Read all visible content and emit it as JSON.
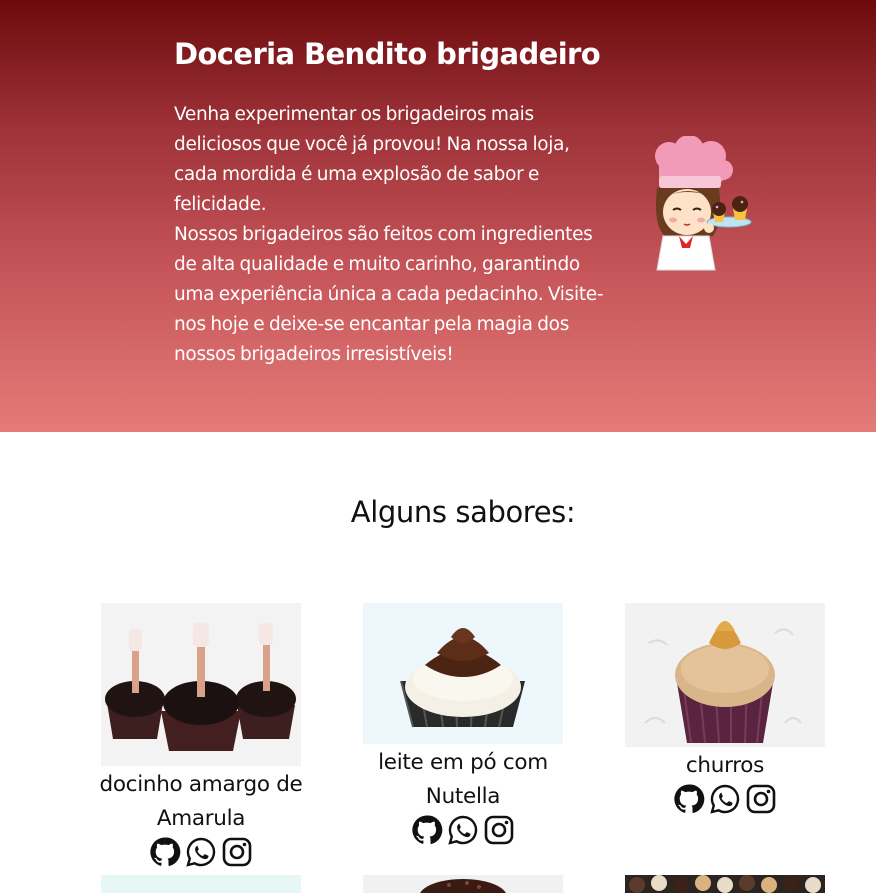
{
  "hero": {
    "title": "Doceria Bendito brigadeiro",
    "paragraph_line_1": "Venha experimentar os brigadeiros mais deliciosos que você já provou! Na nossa loja, cada mordida é uma explosão de sabor e felicidade.",
    "paragraph_line_2": "Nossos brigadeiros são feitos com ingredientes de alta qualidade e muito carinho, garantindo uma experiência única a cada pedacinho. Visite-nos hoje e deixe-se encantar pela magia dos nossos brigadeiros irresistíveis!",
    "mascot_icon": "chef-girl-with-cupcakes-icon"
  },
  "flavors": {
    "title": "Alguns sabores:",
    "items": [
      {
        "name": "docinho amargo de Amarula",
        "photo": "amarula-brigadeiro-photo"
      },
      {
        "name": "leite em pó com Nutella",
        "photo": "nutella-brigadeiro-photo"
      },
      {
        "name": "churros",
        "photo": "churros-brigadeiro-photo"
      }
    ],
    "social_icons": [
      "github-icon",
      "whatsapp-icon",
      "instagram-icon"
    ]
  },
  "colors": {
    "hero_top": "#6d0a0c",
    "hero_bottom": "#e47b78",
    "text_dark": "#111111",
    "text_light": "#ffffff"
  }
}
